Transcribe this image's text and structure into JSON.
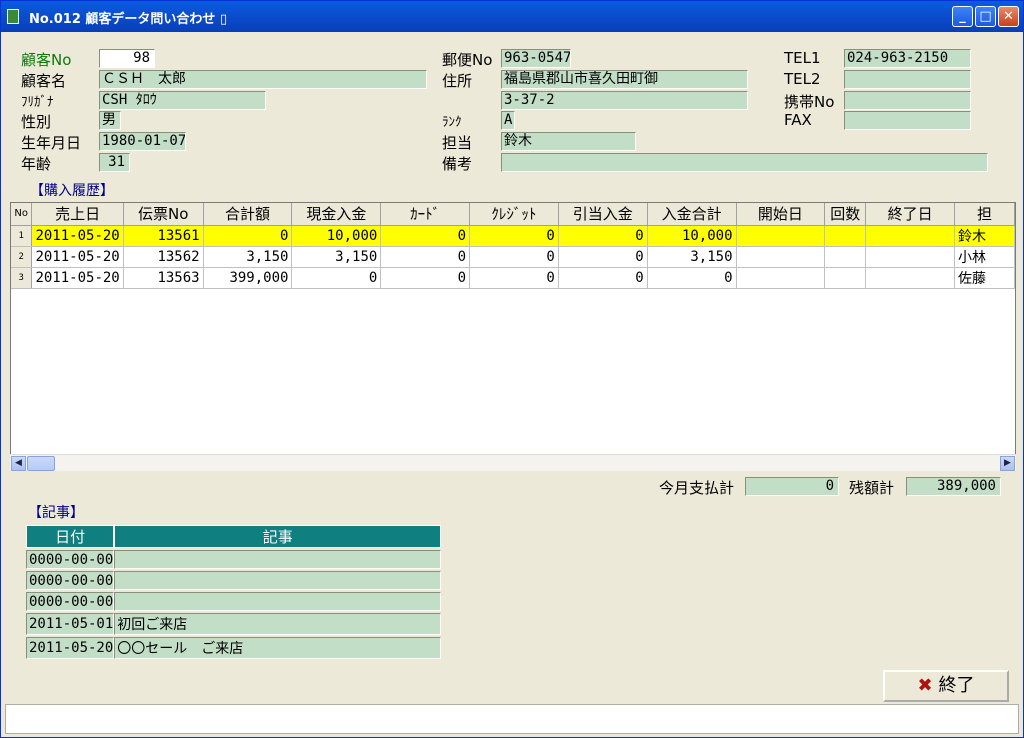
{
  "window": {
    "title": "No.012 顧客データ問い合わせ ▯",
    "min": "_",
    "max": "□",
    "close": "✕"
  },
  "customer": {
    "labels": {
      "no": "顧客No",
      "name": "顧客名",
      "kana": "ﾌﾘｶﾞﾅ",
      "sex": "性別",
      "birth": "生年月日",
      "age": "年齢",
      "zip": "郵便No",
      "address": "住所",
      "rank": "ﾗﾝｸ",
      "staff": "担当",
      "note": "備考",
      "tel1": "TEL1",
      "tel2": "TEL2",
      "mobile": "携帯No",
      "fax": "FAX"
    },
    "values": {
      "no": "98",
      "name": "ＣＳＨ　太郎",
      "kana": "CSH ﾀﾛｳ",
      "sex": "男",
      "birth": "1980-01-07",
      "age": "31",
      "zip": "963-0547",
      "address1": "福島県郡山市喜久田町御",
      "address2": "3-37-2",
      "rank": "A",
      "staff": "鈴木",
      "note": "",
      "tel1": "024-963-2150",
      "tel2": "",
      "mobile": "",
      "fax": ""
    }
  },
  "purchase": {
    "section_label": "【購入履歴】",
    "columns": [
      "No",
      "売上日",
      "伝票No",
      "合計額",
      "現金入金",
      "ｶｰﾄﾞ",
      "ｸﾚｼﾞｯﾄ",
      "引当入金",
      "入金合計",
      "開始日",
      "回数",
      "終了日",
      "担"
    ],
    "rows": [
      {
        "rn": "1",
        "date": "2011-05-20",
        "slip": "13561",
        "total": "0",
        "cash": "10,000",
        "card": "0",
        "credit": "0",
        "alloc": "0",
        "paid": "10,000",
        "start": "",
        "count": "",
        "end": "",
        "staff": "鈴木"
      },
      {
        "rn": "2",
        "date": "2011-05-20",
        "slip": "13562",
        "total": "3,150",
        "cash": "3,150",
        "card": "0",
        "credit": "0",
        "alloc": "0",
        "paid": "3,150",
        "start": "",
        "count": "",
        "end": "",
        "staff": "小林"
      },
      {
        "rn": "3",
        "date": "2011-05-20",
        "slip": "13563",
        "total": "399,000",
        "cash": "0",
        "card": "0",
        "credit": "0",
        "alloc": "0",
        "paid": "0",
        "start": "",
        "count": "",
        "end": "",
        "staff": "佐藤"
      }
    ]
  },
  "totals": {
    "month_label": "今月支払計",
    "month_value": "0",
    "balance_label": "残額計",
    "balance_value": "389,000"
  },
  "memo": {
    "section_label": "【記事】",
    "col_date": "日付",
    "col_text": "記事",
    "rows": [
      {
        "date": "0000-00-00",
        "text": ""
      },
      {
        "date": "0000-00-00",
        "text": ""
      },
      {
        "date": "0000-00-00",
        "text": ""
      },
      {
        "date": "2011-05-01",
        "text": "初回ご来店"
      },
      {
        "date": "2011-05-20",
        "text": "〇〇セール　ご来店"
      }
    ]
  },
  "buttons": {
    "end_icon": "✖",
    "end_label": "終了"
  },
  "scroll": {
    "left": "◀",
    "right": "▶"
  }
}
